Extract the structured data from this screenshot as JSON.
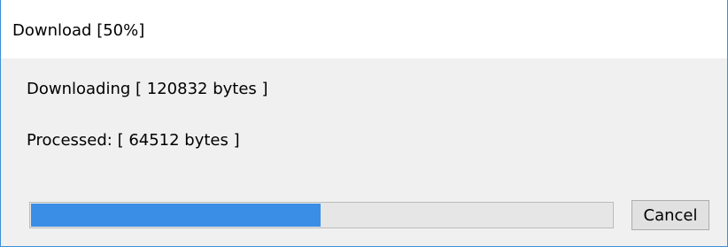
{
  "window": {
    "title": "Download [50%]"
  },
  "status": {
    "downloading": "Downloading [ 120832 bytes ]",
    "processed": "Processed: [ 64512 bytes ]"
  },
  "progress": {
    "percent": 50,
    "fill_color": "#3a8ee6"
  },
  "buttons": {
    "cancel_label": "Cancel"
  },
  "colors": {
    "window_border": "#3c8fd8",
    "dialog_background": "#f0f0f0",
    "progress_track": "#e6e6e6",
    "progress_fill": "#3a8ee6"
  }
}
